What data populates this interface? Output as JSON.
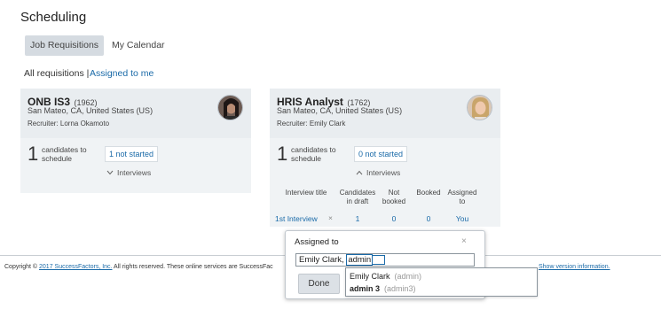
{
  "page": {
    "title": "Scheduling"
  },
  "tabs": [
    {
      "label": "Job Requisitions"
    },
    {
      "label": "My Calendar"
    }
  ],
  "filters": {
    "all": "All requisitions |",
    "assigned": "Assigned to me"
  },
  "cards": [
    {
      "title": "ONB IS3",
      "req_id": "(1962)",
      "location": "San Mateo, CA, United States (US)",
      "recruiter": "Recruiter: Lorna Okamoto",
      "count": "1",
      "count_label_1": "candidates to",
      "count_label_2": "schedule",
      "status": "1 not started",
      "interviews_toggle": "Interviews",
      "chevron": "chevron-down"
    },
    {
      "title": "HRIS Analyst",
      "req_id": "(1762)",
      "location": "San Mateo, CA, United States (US)",
      "recruiter": "Recruiter: Emily Clark",
      "count": "1",
      "count_label_1": "candidates to",
      "count_label_2": "schedule",
      "status": "0 not started",
      "interviews_toggle": "Interviews",
      "chevron": "chevron-up",
      "table": {
        "headers": [
          "Interview title",
          "Candidates in draft",
          "Not booked",
          "Booked",
          "Assigned to"
        ],
        "header_lines": [
          [
            "Interview title"
          ],
          [
            "Candidates",
            "in draft"
          ],
          [
            "Not",
            "booked"
          ],
          [
            "Booked"
          ],
          [
            "Assigned",
            "to"
          ]
        ],
        "row": {
          "title": "1st Interview",
          "remove": "×",
          "draft": "1",
          "not_booked": "0",
          "booked": "0",
          "assigned": "You"
        }
      }
    }
  ],
  "footer": {
    "copyright": "Copyright ©",
    "company_link": "2017 SuccessFactors, Inc.",
    "text": " All rights reserved. These online services are SuccessFac",
    "version_link": "Show version information."
  },
  "popover": {
    "title": "Assigned to",
    "close": "×",
    "input_prefix": "Emily Clark, ",
    "input_typed": "admin",
    "done": "Done",
    "suggestions": [
      {
        "name": "Emily Clark",
        "sub": "(admin)"
      },
      {
        "name": "admin 3",
        "sub": "(admin3)"
      }
    ]
  },
  "colors": {
    "link": "#1a6aa8",
    "card_bg": "#f0f3f5",
    "tab_active_bg": "#d5dbe1"
  }
}
